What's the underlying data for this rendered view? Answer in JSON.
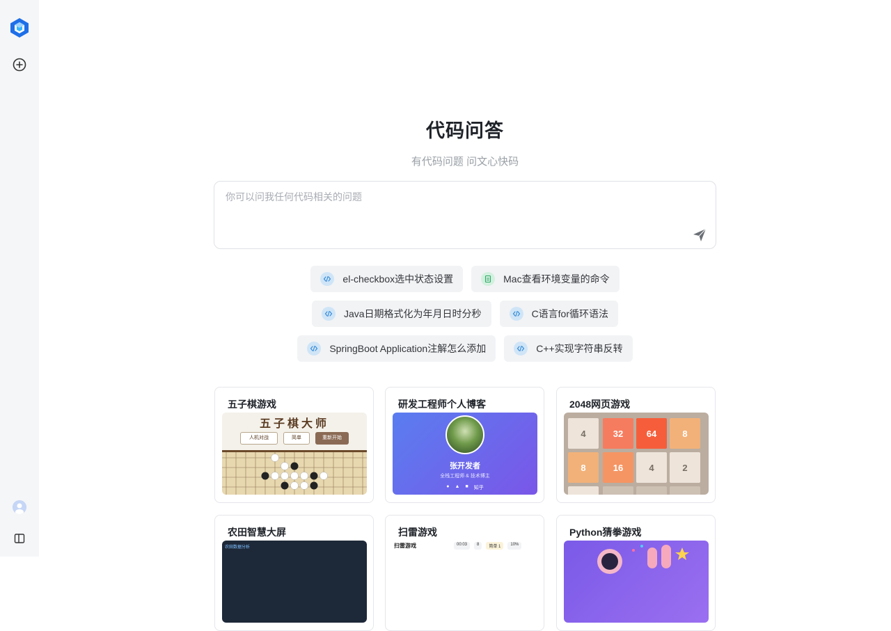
{
  "sidebar": {
    "logo_icon": "cube-logo-icon",
    "new_chat_icon": "plus-circle-icon",
    "avatar_icon": "user-avatar-icon",
    "toggle_icon": "panel-toggle-icon",
    "accent": "#1e6fe8"
  },
  "hero": {
    "title": "代码问答",
    "subtitle": "有代码问题 问文心快码"
  },
  "prompt": {
    "placeholder": "你可以问我任何代码相关的问题",
    "send_icon": "send-icon"
  },
  "suggestions": [
    [
      {
        "label": "el-checkbox选中状态设置",
        "icon": "code-icon"
      },
      {
        "label": "Mac查看环境变量的命令",
        "icon": "doc-icon"
      }
    ],
    [
      {
        "label": "Java日期格式化为年月日时分秒",
        "icon": "code-icon"
      },
      {
        "label": "C语言for循环语法",
        "icon": "code-icon"
      }
    ],
    [
      {
        "label": "SpringBoot Application注解怎么添加",
        "icon": "code-icon"
      },
      {
        "label": "C++实现字符串反转",
        "icon": "code-icon"
      }
    ]
  ],
  "cards": [
    {
      "title": "五子棋游戏",
      "preview": {
        "heading": "五子棋大师",
        "select_1": "人机对战",
        "select_2": "简单",
        "button": "重新开始"
      }
    },
    {
      "title": "研发工程师个人博客",
      "preview": {
        "name": "张开发者",
        "role": "全栈工程师 & 技术博主",
        "link_text": "知乎"
      }
    },
    {
      "title": "2048网页游戏",
      "preview": {
        "tiles": [
          "4",
          "32",
          "64",
          "8",
          "8",
          "16",
          "4",
          "2"
        ]
      }
    },
    {
      "title": "农田智慧大屏",
      "preview": {
        "heading": "农田数据分析"
      }
    },
    {
      "title": "扫雷游戏",
      "preview": {
        "heading": "扫雷游戏",
        "timer": "00:03",
        "mines": "8",
        "level": "简单 1",
        "pct": "10%"
      }
    },
    {
      "title": "Python猜拳游戏",
      "preview": {}
    }
  ]
}
